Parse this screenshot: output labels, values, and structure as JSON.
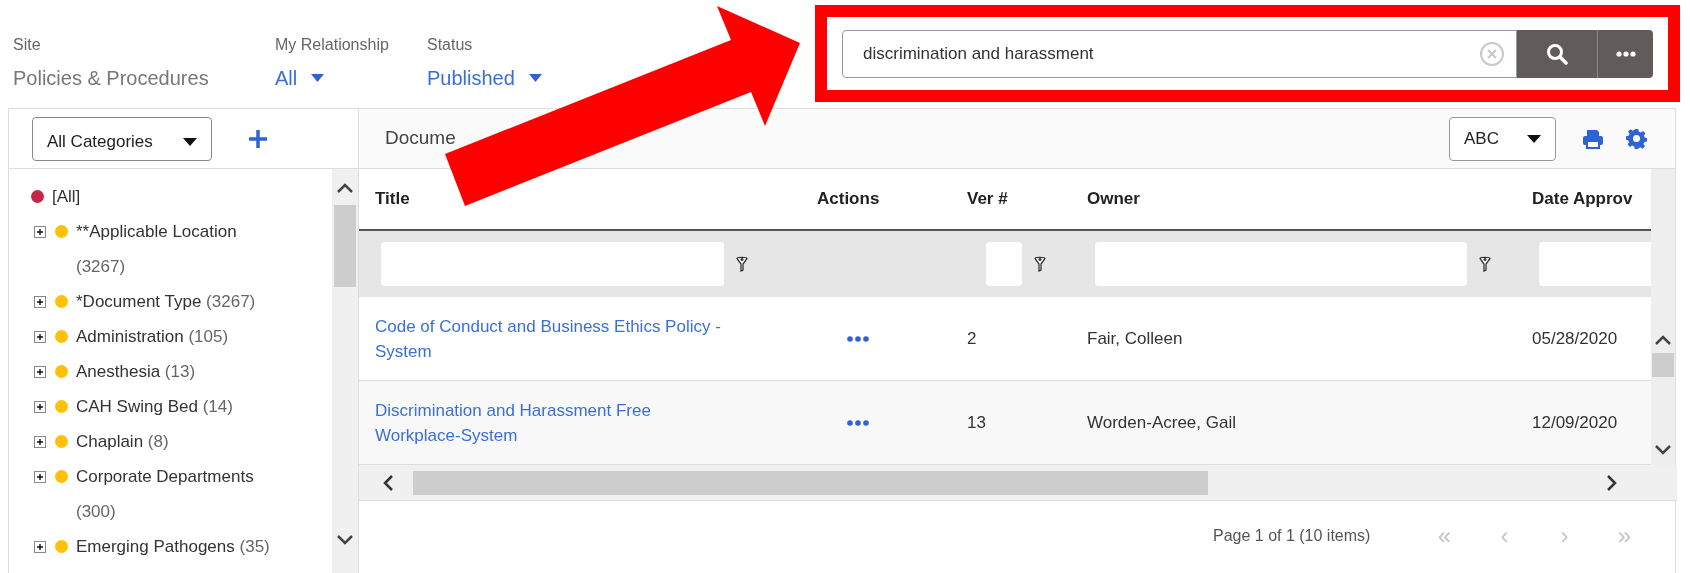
{
  "filters": [
    {
      "label": "Site",
      "value": "Policies & Procedures",
      "kind": "static"
    },
    {
      "label": "My Relationship",
      "value": "All",
      "kind": "dropdown"
    },
    {
      "label": "Status",
      "value": "Published",
      "kind": "dropdown"
    }
  ],
  "search": {
    "value": "discrimination and harassment"
  },
  "category_filter": {
    "value": "All Categories"
  },
  "tree": [
    {
      "label": "[All]",
      "expandable": false,
      "color": "#c8254a"
    },
    {
      "label": "**Applicable Location",
      "count": "(3267)",
      "expandable": true,
      "color": "#ffc107"
    },
    {
      "label": "*Document Type",
      "count": "(3267)",
      "expandable": true,
      "color": "#ffc107"
    },
    {
      "label": "Administration",
      "count": "(105)",
      "expandable": true,
      "color": "#ffc107"
    },
    {
      "label": "Anesthesia",
      "count": "(13)",
      "expandable": true,
      "color": "#ffc107"
    },
    {
      "label": "CAH Swing Bed",
      "count": "(14)",
      "expandable": true,
      "color": "#ffc107"
    },
    {
      "label": "Chaplain",
      "count": "(8)",
      "expandable": true,
      "color": "#ffc107"
    },
    {
      "label": "Corporate Departments",
      "count": "(300)",
      "expandable": true,
      "color": "#ffc107"
    },
    {
      "label": "Emerging Pathogens",
      "count": "(35)",
      "expandable": true,
      "color": "#ffc107"
    }
  ],
  "documents_panel": {
    "title": "Docume",
    "sort": "ABC"
  },
  "table": {
    "columns": [
      {
        "label": "Title",
        "kind": "wide"
      },
      {
        "label": "Actions",
        "kind": "none"
      },
      {
        "label": "Ver #",
        "kind": "narrow"
      },
      {
        "label": "Owner",
        "kind": "wide"
      },
      {
        "label": "Date Approv",
        "kind": "clipped"
      }
    ],
    "rows": [
      {
        "title": "Code of Conduct and Business Ethics Policy - System",
        "ver": "2",
        "owner": "Fair, Colleen",
        "date": "05/28/2020"
      },
      {
        "title": "Discrimination and Harassment Free Workplace-System",
        "ver": "13",
        "owner": "Worden-Acree, Gail",
        "date": "12/09/2020"
      }
    ]
  },
  "pager": {
    "text": "Page 1 of 1 (10 items)",
    "buttons": [
      {
        "label": "«",
        "disabled": true
      },
      {
        "label": "‹",
        "disabled": true
      },
      {
        "label": "›",
        "disabled": true
      },
      {
        "label": "»",
        "disabled": true
      }
    ]
  }
}
